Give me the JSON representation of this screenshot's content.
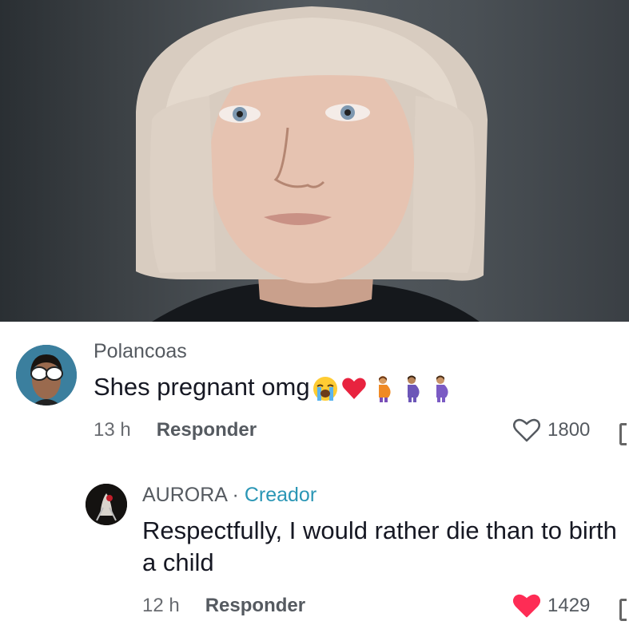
{
  "comments": [
    {
      "username": "Polancoas",
      "text": "Shes pregnant omg",
      "emojis": [
        "loudly-crying-face",
        "red-heart",
        "pregnant-person",
        "pregnant-person",
        "pregnant-person"
      ],
      "time": "13 h",
      "reply_label": "Responder",
      "likes": "1800",
      "liked": false
    },
    {
      "username": "AURORA",
      "separator": "·",
      "badge": "Creador",
      "text": "Respectfully, I would rather die than to birth a child",
      "time": "12 h",
      "reply_label": "Responder",
      "likes": "1429",
      "liked": true
    }
  ],
  "colors": {
    "creator_badge": "#2a96b5",
    "liked_heart": "#fe2c55"
  }
}
